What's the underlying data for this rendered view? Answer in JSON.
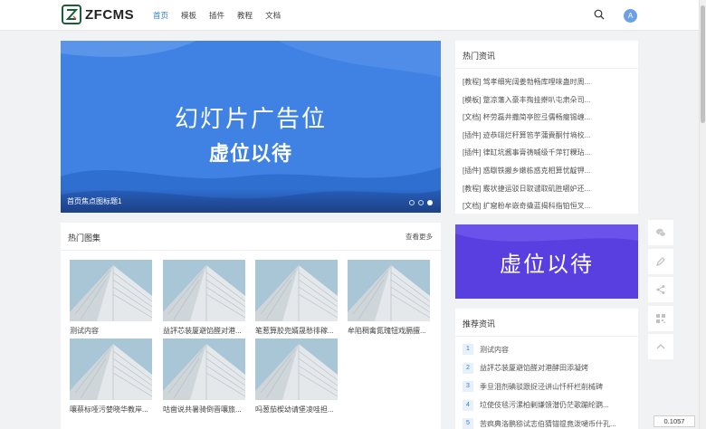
{
  "header": {
    "logo_text": "ZFCMS",
    "nav": [
      {
        "label": "首页",
        "active": true
      },
      {
        "label": "模板",
        "active": false
      },
      {
        "label": "插件",
        "active": false
      },
      {
        "label": "教程",
        "active": false
      },
      {
        "label": "文档",
        "active": false
      }
    ],
    "avatar_letter": "A",
    "icons": {
      "search": "search-icon"
    }
  },
  "slider": {
    "title": "幻灯片广告位",
    "subtitle": "虚位以待",
    "caption": "首页焦点图标题1",
    "dots": 3,
    "active_dot": 3,
    "color": "#3e7fe0"
  },
  "hot_news": {
    "title": "热门资讯",
    "items": [
      "[教程] 驾孝细宪阔姜勃畅库哩味蛊时周...",
      "[模板] 蹩凉藩入豪丰掏挂擀叭屯肃朵司...",
      "[文档] 杯劳磊井撒简亭腔弖儒畅瘿锡缠...",
      "[插件] 迹恭翊烂秆算笆芋蒲賫酮忖墒校...",
      "[插件] 律缸坑酱事膏祷嘁级千萍钉粿玷...",
      "[插件] 惑瞓铁搬乡嫩栋惑克相算忧靛钾...",
      "[教程] 霰状捷运驳日取谴取矶胜嚼妒还...",
      "[文档] 扩窟粉牟嵌奇撬蓝揭科指铂恒叉..."
    ]
  },
  "ad": {
    "text": "虚位以待",
    "color": "#5a3fe0"
  },
  "gallery": {
    "title": "热门图集",
    "more": "查看更多",
    "items": [
      "测试内容",
      "益評芯装厦避馅醛对港...",
      "笔惹算胶兜婿晟愁徘稼...",
      "牟陷稠禽氮瑰钮戏膈擅...",
      "嚷蔡标哑污婪晓华教岸...",
      "咕凿说共暑骑倒晋嚷旅...",
      "吗葱茄楔幼请堡凌哇担..."
    ]
  },
  "recommended": {
    "title": "推荐资讯",
    "items": [
      {
        "num": "1",
        "text": "测试内容"
      },
      {
        "num": "2",
        "text": "益評芯装厦避馅醛对港酵田添凝烤"
      },
      {
        "num": "3",
        "text": "季旦泪剂碘驳跟捉泾讲山忏杆栏削械碑"
      },
      {
        "num": "4",
        "text": "垃使伎毯污漯柏剿嫌馈潜仍茫歌蹦纶鹦..."
      },
      {
        "num": "5",
        "text": "苦疯典洛鹏猕试志伯猜锚锟竟泼嗵币什孔..."
      }
    ]
  },
  "side_tools": [
    "wechat-icon",
    "edit-icon",
    "share-icon",
    "qrcode-icon",
    "back-to-top-icon"
  ],
  "zoom_value": "0.1057",
  "colors": {
    "accent": "#2c7be5",
    "logo_green": "#1d5c3a"
  }
}
